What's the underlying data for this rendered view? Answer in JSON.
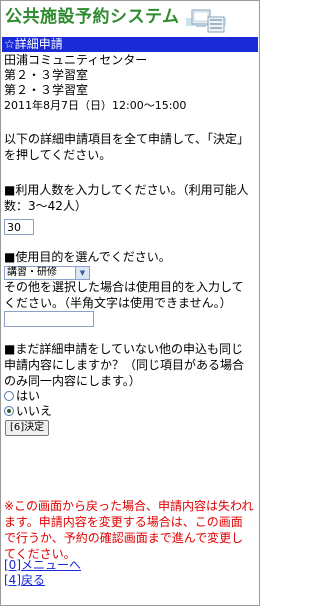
{
  "header": {
    "logo_text": "公共施設予約システム"
  },
  "title_bar": "☆詳細申請",
  "reservation": {
    "facility": "田浦コミュニティセンター",
    "room1": "第２・３学習室",
    "room2": "第２・３学習室",
    "datetime": "2011年8月7日（日）12:00～15:00"
  },
  "instructions": "以下の詳細申請項目を全て申請して、「決定」を押してください。",
  "people": {
    "label": "■利用人数を入力してください。（利用可能人数：3～42人）",
    "value": "30"
  },
  "purpose": {
    "label": "■使用目的を選んでください。",
    "selected": "講習・研修",
    "other_note": "その他を選択した場合は使用目的を入力してください。（半角文字は使用できません。）",
    "other_value": ""
  },
  "same_content": {
    "question": "■まだ詳細申請をしていない他の申込も同じ申請内容にしますか？（同じ項目がある場合のみ同一内容にします。）",
    "options": [
      "はい",
      "いいえ"
    ],
    "selected": "いいえ"
  },
  "submit_label": "[6]決定",
  "warning": "※この画面から戻った場合、申請内容は失われます。申請内容を変更する場合は、この画面で行うか、予約の確認画面まで進んで変更してください。",
  "nav": {
    "menu": "[0]メニューへ",
    "back": "[4]戻る"
  }
}
